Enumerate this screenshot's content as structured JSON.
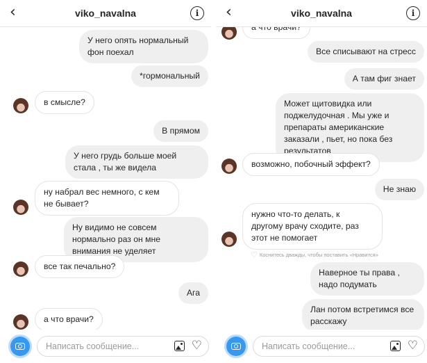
{
  "left": {
    "header": {
      "title": "viko_navalna",
      "back_icon": "chevron-left-icon",
      "info_icon": "info-icon"
    },
    "messages": [
      {
        "side": "out",
        "text": "У него опять нормальный фон поехал"
      },
      {
        "side": "out",
        "text": "*гормональный"
      },
      {
        "side": "in",
        "text": "в смысле?"
      },
      {
        "side": "out",
        "text": "В прямом"
      },
      {
        "side": "out",
        "text": "У него грудь больше моей стала , ты же видела"
      },
      {
        "side": "in",
        "text": "ну набрал вес немного, с кем не бывает?"
      },
      {
        "side": "out",
        "text": "Ну видимо не совсем нормально раз он мне внимания не уделяет"
      },
      {
        "side": "in",
        "text": "все так печально?"
      },
      {
        "side": "out",
        "text": "Ага"
      },
      {
        "side": "in",
        "text": "а что врачи?"
      }
    ],
    "composer": {
      "placeholder": "Написать сообщение..."
    }
  },
  "right": {
    "header": {
      "title": "viko_navalna",
      "back_icon": "chevron-left-icon",
      "info_icon": "info-icon"
    },
    "messages": [
      {
        "side": "in",
        "text": "а что врачи?"
      },
      {
        "side": "out",
        "text": "Все списывают на стресс"
      },
      {
        "side": "out",
        "text": "А там фиг знает"
      },
      {
        "side": "out",
        "text": "Может щитовидка или поджелудочная . Мы уже и препараты американские заказали , пьет, но пока без результатов"
      },
      {
        "side": "in",
        "text": "возможно, побочный эффект?"
      },
      {
        "side": "out",
        "text": "Не знаю"
      },
      {
        "side": "in",
        "text": "нужно что-то делать, к другому врачу сходите, раз этот не помогает"
      },
      {
        "side": "out",
        "text": "Наверное ты права , надо подумать"
      },
      {
        "side": "out",
        "text": "Лан потом встретимся все расскажу"
      }
    ],
    "like_hint": "Коснитесь дважды, чтобы поставить «Нравится»",
    "composer": {
      "placeholder": "Написать сообщение..."
    }
  },
  "icons": {
    "camera": "camera-icon",
    "gallery": "gallery-icon",
    "heart": "heart-icon"
  },
  "colors": {
    "bubble_out": "#efefef",
    "bubble_in_border": "#e3e3e3",
    "camera_button": "#3897f0"
  }
}
